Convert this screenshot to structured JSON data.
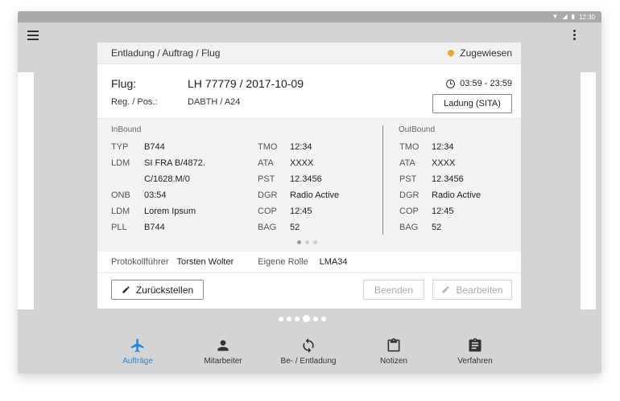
{
  "statusbar": {
    "time": "12:30"
  },
  "card": {
    "breadcrumb": "Entladung / Auftrag / Flug",
    "status": {
      "label": "Zugewiesen",
      "color": "#f4a51c"
    },
    "flight": {
      "flug_label": "Flug:",
      "flug_value": "LH 77779 / 2017-10-09",
      "reg_label": "Reg. / Pos.:",
      "reg_value": "DABTH / A24",
      "time_range": "03:59 - 23:59",
      "ladung_button": "Ladung (SITA)"
    },
    "inbound": {
      "title": "InBound",
      "col1": [
        {
          "k": "TYP",
          "v": "B744"
        },
        {
          "k": "LDM",
          "v": "SI FRA B/4872."
        },
        {
          "k": "",
          "v": "C/1628.M/0"
        },
        {
          "k": "ONB",
          "v": "03:54"
        },
        {
          "k": "LDM",
          "v": "Lorem Ipsum"
        },
        {
          "k": "PLL",
          "v": "B744"
        }
      ],
      "col2": [
        {
          "k": "TMO",
          "v": "12:34"
        },
        {
          "k": "ATA",
          "v": "XXXX"
        },
        {
          "k": "PST",
          "v": "12.3456"
        },
        {
          "k": "DGR",
          "v": "Radio Active"
        },
        {
          "k": "COP",
          "v": "12:45"
        },
        {
          "k": "BAG",
          "v": "52"
        }
      ]
    },
    "outbound": {
      "title": "OutBound",
      "col": [
        {
          "k": "TMO",
          "v": "12:34"
        },
        {
          "k": "ATA",
          "v": "XXXX"
        },
        {
          "k": "PST",
          "v": "12.3456"
        },
        {
          "k": "DGR",
          "v": "Radio Active"
        },
        {
          "k": "COP",
          "v": "12:45"
        },
        {
          "k": "BAG",
          "v": "52"
        }
      ]
    },
    "protokoll": {
      "label": "Protokollführer",
      "value": "Torsten Wolter",
      "rolle_label": "Eigene Rolle",
      "rolle_value": "LMA34"
    },
    "actions": {
      "zurueckstellen": "Zurückstellen",
      "beenden": "Beenden",
      "bearbeiten": "Bearbeiten"
    }
  },
  "bottom_nav": {
    "items": [
      {
        "label": "Aufträge",
        "icon": "airplane-icon",
        "active": true
      },
      {
        "label": "Mitarbeiter",
        "icon": "person-icon",
        "active": false
      },
      {
        "label": "Be- / Entladung",
        "icon": "sync-icon",
        "active": false
      },
      {
        "label": "Notizen",
        "icon": "clipboard-icon",
        "active": false
      },
      {
        "label": "Verfahren",
        "icon": "assignment-icon",
        "active": false
      }
    ]
  },
  "colors": {
    "accent": "#1e88e5",
    "status": "#f4a51c"
  }
}
